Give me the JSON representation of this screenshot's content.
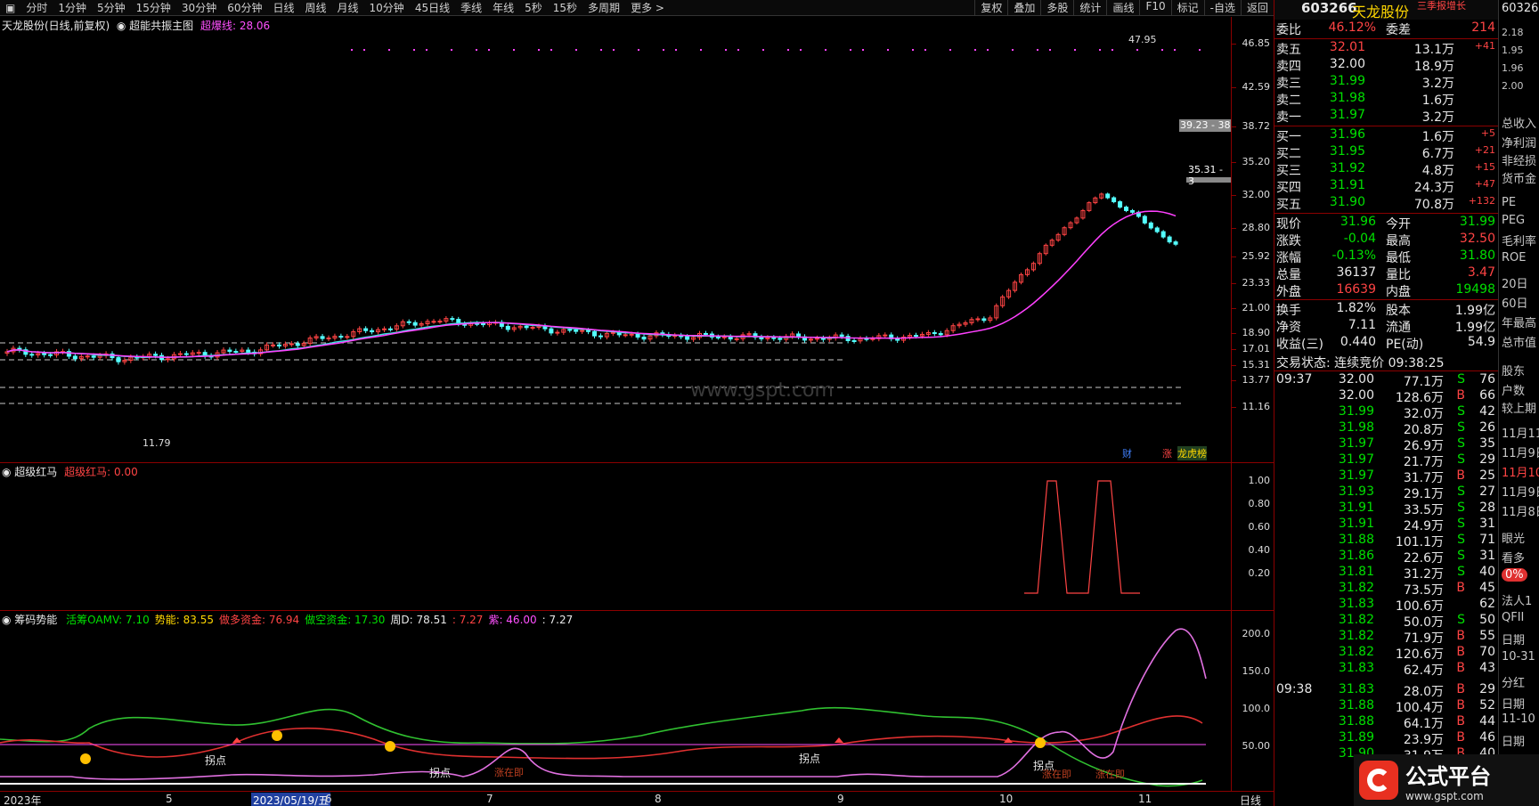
{
  "toolbar": {
    "left_items": [
      "分时",
      "1分钟",
      "5分钟",
      "15分钟",
      "30分钟",
      "60分钟",
      "日线",
      "周线",
      "月线",
      "10分钟",
      "45日线",
      "季线",
      "年线",
      "5秒",
      "15秒",
      "多周期",
      "更多 >"
    ],
    "right_items": [
      "复权",
      "叠加",
      "多股",
      "统计",
      "画线",
      "F10",
      "标记",
      "-自选",
      "返回"
    ]
  },
  "main_chart": {
    "title": "天龙股份(日线,前复权)",
    "indicator_name": "超能共振主图",
    "indicator_value": "超爆线: 28.06",
    "watermark": "www.gspt.com",
    "y_ticks": [
      "46.85",
      "42.59",
      "38.72",
      "35.20",
      "32.00",
      "28.80",
      "25.92",
      "23.33",
      "21.00",
      "18.90",
      "17.01",
      "15.31",
      "13.77",
      "11.16"
    ],
    "hi_label": "47.95",
    "lo_label": "11.79",
    "price_box_1": "39.23 - 38",
    "price_box_1_tag": "39.16",
    "price_box_2": "35.31 - 3",
    "markers": [
      "财",
      "涨",
      "龙虎榜"
    ]
  },
  "panel2": {
    "title": "超级红马",
    "value": "超级红马: 0.00",
    "y_ticks": [
      "1.00",
      "0.80",
      "0.60",
      "0.40",
      "0.20"
    ]
  },
  "panel3": {
    "title": "筹码势能",
    "items": [
      {
        "text": "活筹OAMV: 7.10",
        "color": "#00e000"
      },
      {
        "text": "势能: 83.55",
        "color": "#ffd700"
      },
      {
        "text": "做多资金: 76.94",
        "color": "#ff4444"
      },
      {
        "text": "做空资金: 17.30",
        "color": "#00e000"
      },
      {
        "text": "周D: 78.51",
        "color": "#e8e8e8"
      },
      {
        "text": ": 7.27",
        "color": "#ff4444"
      },
      {
        "text": "紫: 46.00",
        "color": "#ff50ff"
      },
      {
        "text": ": 7.27",
        "color": "#e8e8e8"
      }
    ],
    "y_ticks": [
      "200.0",
      "150.0",
      "100.0",
      "50.00"
    ],
    "labels": [
      "拐点",
      "拐点",
      "拐点",
      "拐点"
    ],
    "small_labels": [
      "涨在即",
      "涨在即",
      "涨在即"
    ]
  },
  "xaxis": {
    "labels": [
      "2023年",
      "5",
      "2023/05/19/五",
      "6",
      "7",
      "8",
      "9",
      "10",
      "11"
    ],
    "period": "日线"
  },
  "quote": {
    "code": "603266",
    "name": "天龙股份",
    "tag": "三季报增长",
    "weibi_label": "委比",
    "weibi_value": "46.12%",
    "weicha_label": "委差",
    "weicha_value": "214",
    "asks": [
      {
        "label": "卖五",
        "price": "32.01",
        "vol": "13.1万",
        "chg": "+41",
        "pcolor": "#ff4444"
      },
      {
        "label": "卖四",
        "price": "32.00",
        "vol": "18.9万",
        "chg": "",
        "pcolor": "#e8e8e8"
      },
      {
        "label": "卖三",
        "price": "31.99",
        "vol": "3.2万",
        "chg": "",
        "pcolor": "#00e000"
      },
      {
        "label": "卖二",
        "price": "31.98",
        "vol": "1.6万",
        "chg": "",
        "pcolor": "#00e000"
      },
      {
        "label": "卖一",
        "price": "31.97",
        "vol": "3.2万",
        "chg": "",
        "pcolor": "#00e000"
      }
    ],
    "bids": [
      {
        "label": "买一",
        "price": "31.96",
        "vol": "1.6万",
        "chg": "+5",
        "pcolor": "#00e000"
      },
      {
        "label": "买二",
        "price": "31.95",
        "vol": "6.7万",
        "chg": "+21",
        "pcolor": "#00e000"
      },
      {
        "label": "买三",
        "price": "31.92",
        "vol": "4.8万",
        "chg": "+15",
        "pcolor": "#00e000"
      },
      {
        "label": "买四",
        "price": "31.91",
        "vol": "24.3万",
        "chg": "+47",
        "pcolor": "#00e000"
      },
      {
        "label": "买五",
        "price": "31.90",
        "vol": "70.8万",
        "chg": "+132",
        "pcolor": "#00e000"
      }
    ],
    "stats": [
      {
        "l1": "现价",
        "v1": "31.96",
        "c1": "#00e000",
        "l2": "今开",
        "v2": "31.99",
        "c2": "#00e000"
      },
      {
        "l1": "涨跌",
        "v1": "-0.04",
        "c1": "#00e000",
        "l2": "最高",
        "v2": "32.50",
        "c2": "#ff4444"
      },
      {
        "l1": "涨幅",
        "v1": "-0.13%",
        "c1": "#00e000",
        "l2": "最低",
        "v2": "31.80",
        "c2": "#00e000"
      },
      {
        "l1": "总量",
        "v1": "36137",
        "c1": "#e8e8e8",
        "l2": "量比",
        "v2": "3.47",
        "c2": "#ff4444"
      },
      {
        "l1": "外盘",
        "v1": "16639",
        "c1": "#ff4444",
        "l2": "内盘",
        "v2": "19498",
        "c2": "#00e000"
      }
    ],
    "fund": [
      {
        "l1": "换手",
        "v1": "1.82%",
        "l2": "股本",
        "v2": "1.99亿"
      },
      {
        "l1": "净资",
        "v1": "7.11",
        "l2": "流通",
        "v2": "1.99亿"
      },
      {
        "l1": "收益(三)",
        "v1": "0.440",
        "l2": "PE(动)",
        "v2": "54.9"
      }
    ],
    "status": "交易状态: 连续竞价 09:38:25",
    "ticks": [
      {
        "t": "09:37",
        "p": "32.00",
        "v": "77.1万",
        "bs": "S",
        "n": "76",
        "pc": "#e8e8e8"
      },
      {
        "t": "",
        "p": "32.00",
        "v": "128.6万",
        "bs": "B",
        "n": "66",
        "pc": "#e8e8e8"
      },
      {
        "t": "",
        "p": "31.99",
        "v": "32.0万",
        "bs": "S",
        "n": "42",
        "pc": "#00e000"
      },
      {
        "t": "",
        "p": "31.98",
        "v": "20.8万",
        "bs": "S",
        "n": "26",
        "pc": "#00e000"
      },
      {
        "t": "",
        "p": "31.97",
        "v": "26.9万",
        "bs": "S",
        "n": "35",
        "pc": "#00e000"
      },
      {
        "t": "",
        "p": "31.97",
        "v": "21.7万",
        "bs": "S",
        "n": "29",
        "pc": "#00e000"
      },
      {
        "t": "",
        "p": "31.97",
        "v": "31.7万",
        "bs": "B",
        "n": "25",
        "pc": "#00e000"
      },
      {
        "t": "",
        "p": "31.93",
        "v": "29.1万",
        "bs": "S",
        "n": "27",
        "pc": "#00e000"
      },
      {
        "t": "",
        "p": "31.91",
        "v": "33.5万",
        "bs": "S",
        "n": "28",
        "pc": "#00e000"
      },
      {
        "t": "",
        "p": "31.91",
        "v": "24.9万",
        "bs": "S",
        "n": "31",
        "pc": "#00e000"
      },
      {
        "t": "",
        "p": "31.88",
        "v": "101.1万",
        "bs": "S",
        "n": "71",
        "pc": "#00e000"
      },
      {
        "t": "",
        "p": "31.86",
        "v": "22.6万",
        "bs": "S",
        "n": "31",
        "pc": "#00e000"
      },
      {
        "t": "",
        "p": "31.81",
        "v": "31.2万",
        "bs": "S",
        "n": "40",
        "pc": "#00e000"
      },
      {
        "t": "",
        "p": "31.82",
        "v": "73.5万",
        "bs": "B",
        "n": "45",
        "pc": "#00e000"
      },
      {
        "t": "",
        "p": "31.83",
        "v": "100.6万",
        "bs": "",
        "n": "62",
        "pc": "#00e000"
      },
      {
        "t": "",
        "p": "31.82",
        "v": "50.0万",
        "bs": "S",
        "n": "50",
        "pc": "#00e000"
      },
      {
        "t": "",
        "p": "31.82",
        "v": "71.9万",
        "bs": "B",
        "n": "55",
        "pc": "#00e000"
      },
      {
        "t": "",
        "p": "31.82",
        "v": "120.6万",
        "bs": "B",
        "n": "70",
        "pc": "#00e000"
      },
      {
        "t": "",
        "p": "31.83",
        "v": "62.4万",
        "bs": "B",
        "n": "43",
        "pc": "#00e000"
      },
      {
        "t": "09:38",
        "p": "31.83",
        "v": "28.0万",
        "bs": "B",
        "n": "29",
        "pc": "#00e000"
      },
      {
        "t": "",
        "p": "31.88",
        "v": "100.4万",
        "bs": "B",
        "n": "52",
        "pc": "#00e000"
      },
      {
        "t": "",
        "p": "31.88",
        "v": "64.1万",
        "bs": "B",
        "n": "44",
        "pc": "#00e000"
      },
      {
        "t": "",
        "p": "31.89",
        "v": "23.9万",
        "bs": "B",
        "n": "46",
        "pc": "#00e000"
      },
      {
        "t": "",
        "p": "31.90",
        "v": "31.9万",
        "bs": "B",
        "n": "40",
        "pc": "#00e000"
      }
    ]
  },
  "far_right": {
    "code": "60326",
    "items": [
      "2.18",
      "1.95",
      "1.96",
      "2.00",
      "总收入",
      "净利润",
      "非经损",
      "货币金",
      "PE",
      "PEG",
      "毛利率",
      "ROE",
      "20日",
      "60日",
      "年最高",
      "总市值",
      "股东",
      "户数",
      "较上期",
      "11月11",
      "11月9日",
      "11月10",
      "11月9日",
      "11月8日",
      "眼光",
      "看多",
      "0%",
      "法人1",
      "QFII",
      "日期",
      "10-31",
      "分红",
      "日期",
      "11-10",
      "日期"
    ]
  },
  "brand": {
    "name": "公式平台",
    "url": "www.gspt.com"
  }
}
